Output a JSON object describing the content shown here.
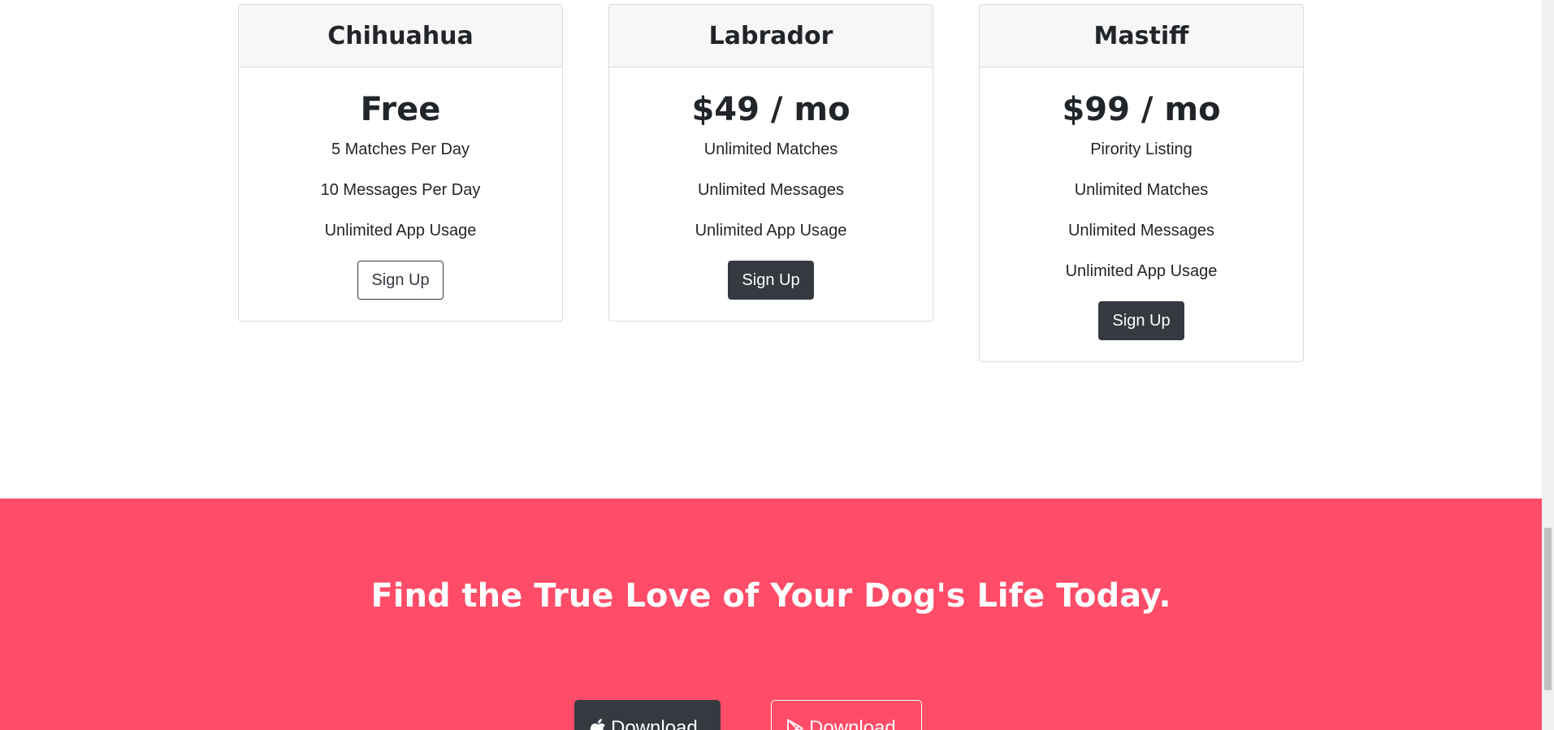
{
  "pricing": {
    "plans": [
      {
        "name": "Chihuahua",
        "price": "Free",
        "features": [
          "5 Matches Per Day",
          "10 Messages Per Day",
          "Unlimited App Usage"
        ],
        "button_label": "Sign Up",
        "button_style": "outline"
      },
      {
        "name": "Labrador",
        "price": "$49 / mo",
        "features": [
          "Unlimited Matches",
          "Unlimited Messages",
          "Unlimited App Usage"
        ],
        "button_label": "Sign Up",
        "button_style": "dark"
      },
      {
        "name": "Mastiff",
        "price": "$99 / mo",
        "features": [
          "Pirority Listing",
          "Unlimited Matches",
          "Unlimited Messages",
          "Unlimited App Usage"
        ],
        "button_label": "Sign Up",
        "button_style": "dark"
      }
    ]
  },
  "cta": {
    "heading": "Find the True Love of Your Dog's Life Today.",
    "apple_download_label": "Download",
    "apple_icon": "apple-icon",
    "google_download_label": "Download",
    "google_icon": "google-play-icon",
    "background_color": "#ff4c68"
  },
  "colors": {
    "dark_button": "#343a40",
    "card_header_bg": "#f7f7f7",
    "accent": "#ff4c68"
  }
}
